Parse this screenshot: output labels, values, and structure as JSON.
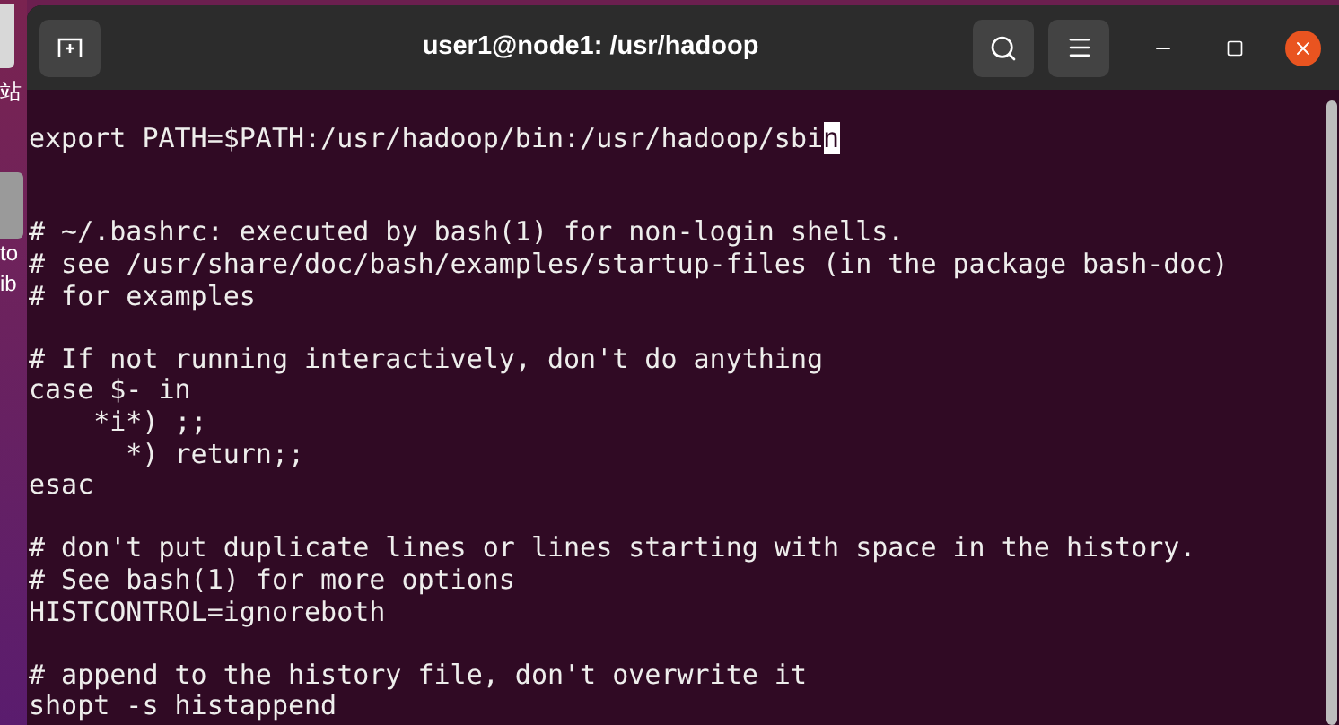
{
  "desktop": {
    "labels": [
      "站",
      "to",
      "ib"
    ]
  },
  "window": {
    "title": "user1@node1: /usr/hadoop"
  },
  "terminal": {
    "lines": [
      {
        "kind": "blank"
      },
      {
        "kind": "text",
        "text": "export PATH=$PATH:/usr/hadoop/bin:/usr/hadoop/sbi",
        "cursor": "n"
      },
      {
        "kind": "blank"
      },
      {
        "kind": "blank"
      },
      {
        "kind": "text",
        "text": "# ~/.bashrc: executed by bash(1) for non-login shells."
      },
      {
        "kind": "text",
        "text": "# see /usr/share/doc/bash/examples/startup-files (in the package bash-doc)"
      },
      {
        "kind": "text",
        "text": "# for examples"
      },
      {
        "kind": "blank"
      },
      {
        "kind": "text",
        "text": "# If not running interactively, don't do anything"
      },
      {
        "kind": "text",
        "text": "case $- in"
      },
      {
        "kind": "text",
        "text": "    *i*) ;;"
      },
      {
        "kind": "text",
        "text": "      *) return;;"
      },
      {
        "kind": "text",
        "text": "esac"
      },
      {
        "kind": "blank"
      },
      {
        "kind": "text",
        "text": "# don't put duplicate lines or lines starting with space in the history."
      },
      {
        "kind": "text",
        "text": "# See bash(1) for more options"
      },
      {
        "kind": "text",
        "text": "HISTCONTROL=ignoreboth"
      },
      {
        "kind": "blank"
      },
      {
        "kind": "text",
        "text": "# append to the history file, don't overwrite it"
      },
      {
        "kind": "text",
        "text": "shopt -s histappend"
      }
    ]
  }
}
